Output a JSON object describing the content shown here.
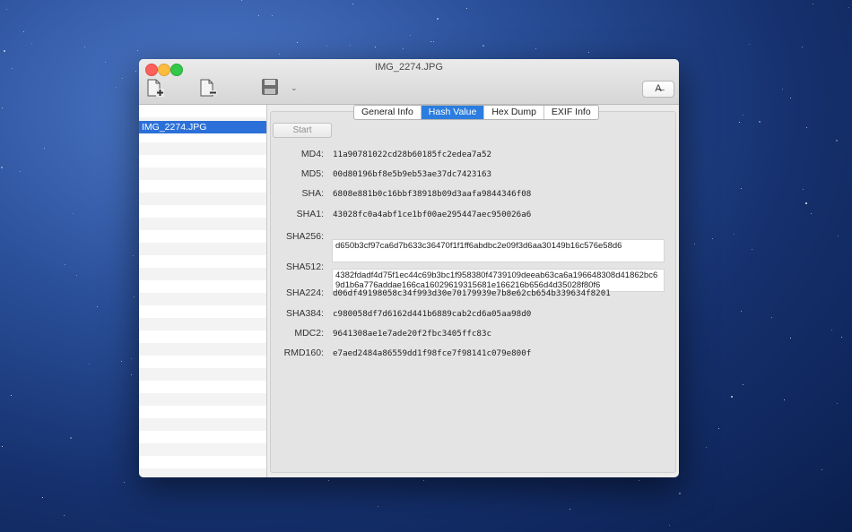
{
  "window": {
    "title": "IMG_2274.JPG"
  },
  "toolbar": {
    "add_icon": "add-file-icon",
    "remove_icon": "remove-file-icon",
    "save_icon": "save-disk-icon",
    "dropdown_glyph": "⌄",
    "right_glyph": "A̶"
  },
  "sidebar": {
    "files": [
      "IMG_2274.JPG"
    ]
  },
  "tabs": [
    {
      "label": "General Info",
      "active": false
    },
    {
      "label": "Hash Value",
      "active": true
    },
    {
      "label": "Hex Dump",
      "active": false
    },
    {
      "label": "EXIF Info",
      "active": false
    }
  ],
  "start_label": "Start",
  "hashes": {
    "md4": {
      "label": "MD4:",
      "value": "11a90781022cd28b60185fc2edea7a52"
    },
    "md5": {
      "label": "MD5:",
      "value": "00d80196bf8e5b9eb53ae37dc7423163"
    },
    "sha": {
      "label": "SHA:",
      "value": "6808e881b0c16bbf38918b09d3aafa9844346f08"
    },
    "sha1": {
      "label": "SHA1:",
      "value": "43028fc0a4abf1ce1bf00ae295447aec950026a6"
    },
    "sha256": {
      "label": "SHA256:",
      "value": "d650b3cf97ca6d7b633c36470f1f1ff6abdbc2e09f3d6aa30149b16c576e58d6"
    },
    "sha512": {
      "label": "SHA512:",
      "value": "4382fdadf4d75f1ec44c69b3bc1f958380f4739109deeab63ca6a196648308d41862bc69d1b6a776addae166ca16029619315681e166216b656d4d35028f80f6"
    },
    "sha224": {
      "label": "SHA224:",
      "value": "d06df49198058c34f993d30e70179939e7b8e62cb654b339634f8201"
    },
    "sha384": {
      "label": "SHA384:",
      "value": "c980058df7d6162d441b6889cab2cd6a05aa98d0"
    },
    "mdc2": {
      "label": "MDC2:",
      "value": "9641308ae1e7ade20f2fbc3405ffc83c"
    },
    "rmd160": {
      "label": "RMD160:",
      "value": "e7aed2484a86559dd1f98fce7f98141c079e800f"
    }
  }
}
